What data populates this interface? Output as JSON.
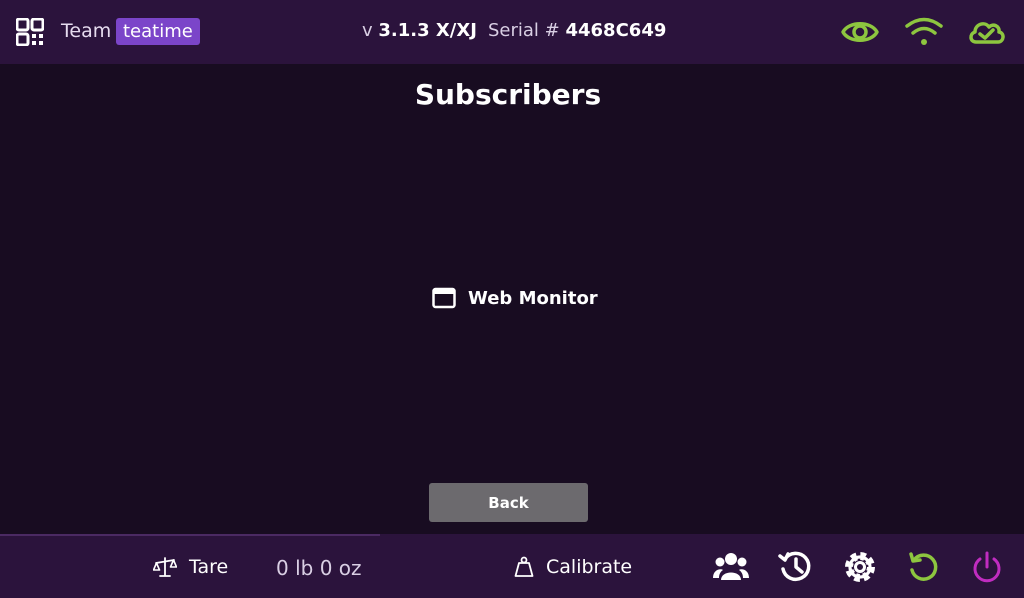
{
  "header": {
    "team_label": "Team",
    "team_name": "teatime",
    "version_prefix": "v",
    "version": "3.1.3 X/XJ",
    "serial_prefix": "Serial #",
    "serial": "4468C649",
    "status_icons": [
      "eye-icon",
      "wifi-icon",
      "cloud-check-icon"
    ]
  },
  "main": {
    "title": "Subscribers",
    "subscribers": [
      {
        "icon": "browser-window-icon",
        "label": "Web Monitor"
      }
    ],
    "back_label": "Back"
  },
  "footer": {
    "tare_label": "Tare",
    "weight": "0 lb 0 oz",
    "calibrate_label": "Calibrate",
    "nav_icons": [
      "users-icon",
      "history-icon",
      "gear-icon",
      "undo-icon",
      "power-icon"
    ]
  },
  "colors": {
    "background": "#180c21",
    "bar": "#2b133c",
    "accent_green": "#8dc63f",
    "accent_purple": "#7b45c9",
    "power_magenta": "#c02cc0",
    "button_gray": "#6c6a6e"
  }
}
